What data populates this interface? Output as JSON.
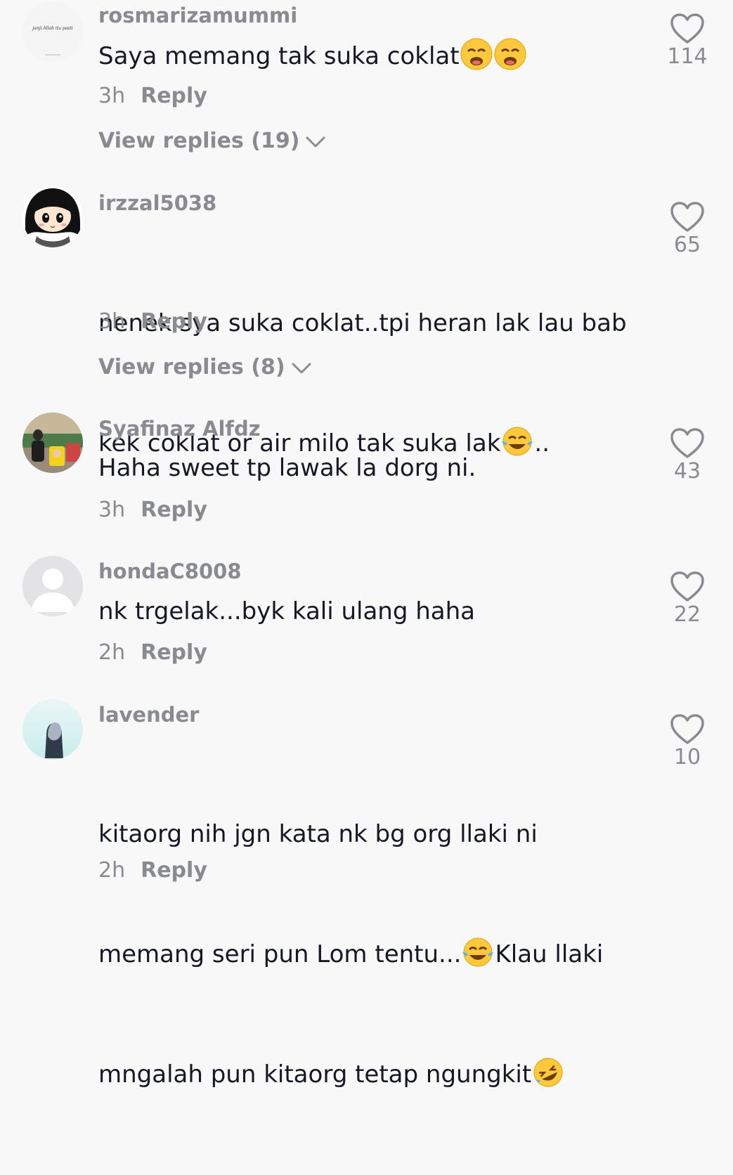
{
  "comments": [
    {
      "username": "rosmarizamummi",
      "avatar_text": "janji Allah itu pasti",
      "text_before": "Saya memang tak suka coklat",
      "emojis": [
        "weary-face-emoji",
        "weary-face-emoji"
      ],
      "text_after": "",
      "time": "3h",
      "reply_label": "Reply",
      "view_replies": "View replies (19)",
      "likes": "114"
    },
    {
      "username": "irzzal5038",
      "text_line1": "nenek sya suka coklat..tpi heran lak lau bab",
      "text_line2_before": "kek coklat or air milo tak suka lak",
      "text_line2_after": "..",
      "time": "3h",
      "reply_label": "Reply",
      "view_replies": "View replies (8)",
      "likes": "65"
    },
    {
      "username": "Syafinaz Alfdz",
      "text": "Haha sweet tp lawak la dorg ni.",
      "time": "3h",
      "reply_label": "Reply",
      "likes": "43"
    },
    {
      "username": "hondaC8008",
      "text": "nk trgelak...byk kali ulang haha",
      "time": "2h",
      "reply_label": "Reply",
      "likes": "22"
    },
    {
      "username": "lavender",
      "text_line1": "kitaorg nih jgn kata nk bg org llaki ni",
      "text_line2_before": "memang seri pun Lom tentu...",
      "text_line2_after": "Klau llaki",
      "text_line3_before": "mngalah pun kitaorg tetap ngungkit",
      "time": "2h",
      "reply_label": "Reply",
      "likes": "10"
    }
  ],
  "colors": {
    "background": "#f8f8f8",
    "primary_text": "#161823",
    "secondary_text": "#8a8b91"
  }
}
